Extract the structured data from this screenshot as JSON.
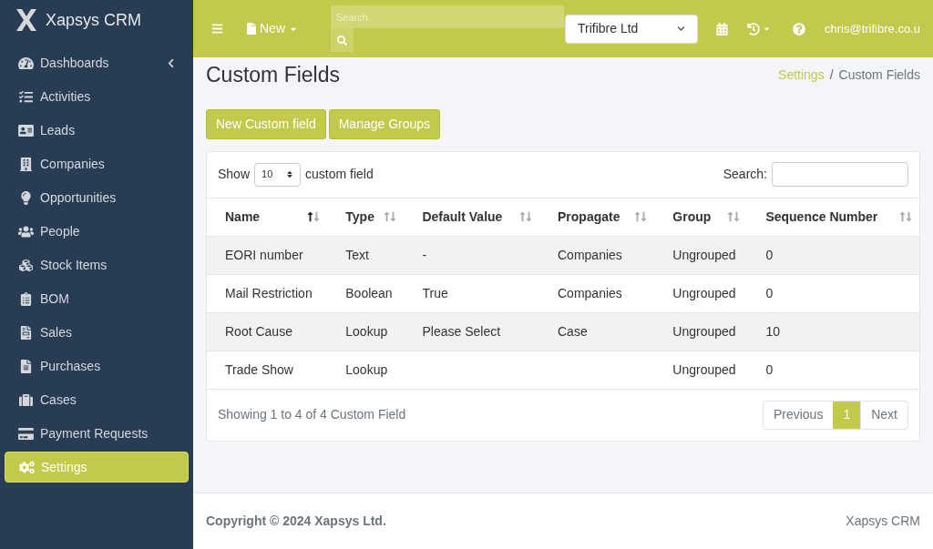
{
  "brand": {
    "name": "Xapsys CRM"
  },
  "sidebar": {
    "items": [
      {
        "label": "Dashboards",
        "selected": false,
        "expandable": true
      },
      {
        "label": "Activities",
        "selected": false,
        "expandable": false
      },
      {
        "label": "Leads",
        "selected": false,
        "expandable": false
      },
      {
        "label": "Companies",
        "selected": false,
        "expandable": false
      },
      {
        "label": "Opportunities",
        "selected": false,
        "expandable": false
      },
      {
        "label": "People",
        "selected": false,
        "expandable": false
      },
      {
        "label": "Stock Items",
        "selected": false,
        "expandable": false
      },
      {
        "label": "BOM",
        "selected": false,
        "expandable": false
      },
      {
        "label": "Sales",
        "selected": false,
        "expandable": false
      },
      {
        "label": "Purchases",
        "selected": false,
        "expandable": false
      },
      {
        "label": "Cases",
        "selected": false,
        "expandable": false
      },
      {
        "label": "Payment Requests",
        "selected": false,
        "expandable": false
      },
      {
        "label": "Settings",
        "selected": true,
        "expandable": false
      }
    ]
  },
  "topbar": {
    "new_label": "New",
    "search": {
      "placeholder": "Search"
    },
    "company": "Trifibre Ltd",
    "user": "chris@trifibre.co.u"
  },
  "page": {
    "title": "Custom Fields",
    "breadcrumb_separator": "/",
    "breadcrumb": [
      {
        "label": "Settings",
        "link": true
      },
      {
        "label": "Custom Fields",
        "link": false
      }
    ],
    "buttons": [
      "New Custom field",
      "Manage Groups"
    ]
  },
  "table": {
    "show_label": "Show",
    "page_size": "10",
    "show_suffix": "custom field",
    "search_label": "Search:",
    "columns": [
      {
        "label": "Name",
        "sorted": true
      },
      {
        "label": "Type",
        "sorted": false
      },
      {
        "label": "Default Value",
        "sorted": false
      },
      {
        "label": "Propagate",
        "sorted": false
      },
      {
        "label": "Group",
        "sorted": false
      },
      {
        "label": "Sequence Number",
        "sorted": false
      }
    ],
    "rows": [
      [
        "EORI number",
        "Text",
        "-",
        "Companies",
        "Ungrouped",
        "0"
      ],
      [
        "Mail Restriction",
        "Boolean",
        "True",
        "Companies",
        "Ungrouped",
        "0"
      ],
      [
        "Root Cause",
        "Lookup",
        "Please Select",
        "Case",
        "Ungrouped",
        "10"
      ],
      [
        "Trade Show",
        "Lookup",
        "",
        "",
        "Ungrouped",
        "0"
      ]
    ],
    "info": "Showing 1 to 4 of 4 Custom Field",
    "pagination": {
      "previous": "Previous",
      "pages": [
        {
          "label": "1",
          "selected": true
        }
      ],
      "next": "Next"
    }
  },
  "footer": {
    "copyright": "Copyright © 2024 Xapsys Ltd.",
    "app": "Xapsys CRM"
  }
}
